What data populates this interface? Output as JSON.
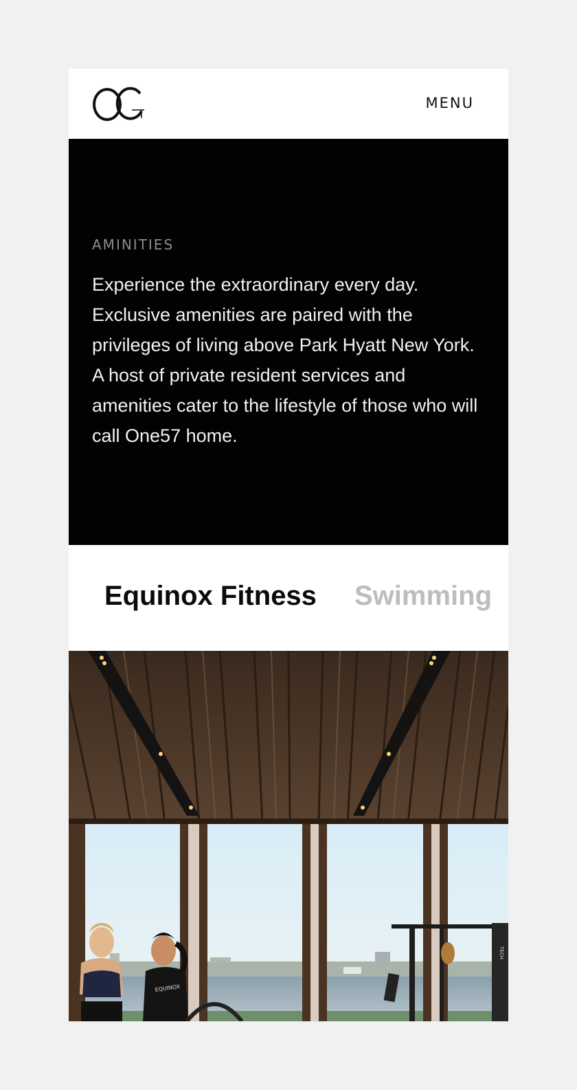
{
  "header": {
    "logo_name": "OG monogram",
    "menu_label": "MENU"
  },
  "intro": {
    "eyebrow": "AMINITIES",
    "body": "Experience the extraordinary every day. Exclusive amenities are paired with the privileges of living above Park Hyatt New York. A host of private resident services and amenities cater to the lifestyle of those who will call One57 home."
  },
  "tabs": [
    {
      "label": "Equinox Fitness",
      "active": true
    },
    {
      "label": "Swimming",
      "active": false
    }
  ],
  "photo": {
    "shirt_text": "EQUINOX",
    "machine_text": "TECH"
  },
  "colors": {
    "page_bg": "#f1f1f1",
    "intro_bg": "#020203",
    "eyebrow": "#8d8d8d",
    "tab_active": "#0a0a0a",
    "tab_inactive": "#bdbdbd"
  }
}
